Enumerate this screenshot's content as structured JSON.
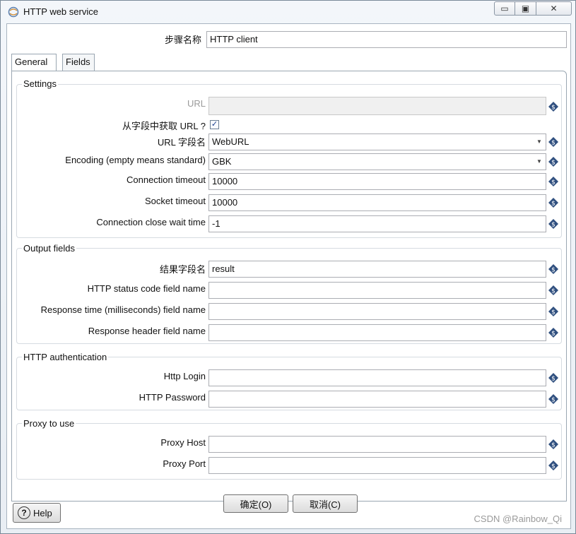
{
  "window": {
    "title": "HTTP web service",
    "minimize_glyph": "▭",
    "maximize_glyph": "▣",
    "close_glyph": "✕"
  },
  "step": {
    "label": "步骤名称",
    "value": "HTTP client"
  },
  "tabs": [
    {
      "label": "General"
    },
    {
      "label": "Fields"
    }
  ],
  "settings": {
    "title": "Settings",
    "url_label": "URL",
    "url_value": "",
    "from_field_label": "从字段中获取 URL ?",
    "from_field_checked": "✓",
    "url_field_label": "URL 字段名",
    "url_field_value": "WebURL",
    "encoding_label": "Encoding (empty means standard)",
    "encoding_value": "GBK",
    "conn_timeout_label": "Connection timeout",
    "conn_timeout_value": "10000",
    "socket_timeout_label": "Socket timeout",
    "socket_timeout_value": "10000",
    "close_wait_label": "Connection close wait time",
    "close_wait_value": "-1"
  },
  "output": {
    "title": "Output fields",
    "result_label": "结果字段名",
    "result_value": "result",
    "status_label": "HTTP status code field name",
    "status_value": "",
    "resp_time_label": "Response time (milliseconds) field name",
    "resp_time_value": "",
    "resp_header_label": "Response header field name",
    "resp_header_value": ""
  },
  "auth": {
    "title": "HTTP authentication",
    "login_label": "Http Login",
    "login_value": "",
    "password_label": "HTTP Password",
    "password_value": ""
  },
  "proxy": {
    "title": "Proxy to use",
    "host_label": "Proxy Host",
    "host_value": "",
    "port_label": "Proxy Port",
    "port_value": ""
  },
  "buttons": {
    "ok": "确定(O)",
    "cancel": "取消(C)",
    "help": "Help",
    "help_glyph": "?"
  },
  "watermark": "CSDN @Rainbow_Qi",
  "colors": {
    "variable_icon": "#2f4f7f",
    "checkbox_check": "#1b3f8b"
  }
}
